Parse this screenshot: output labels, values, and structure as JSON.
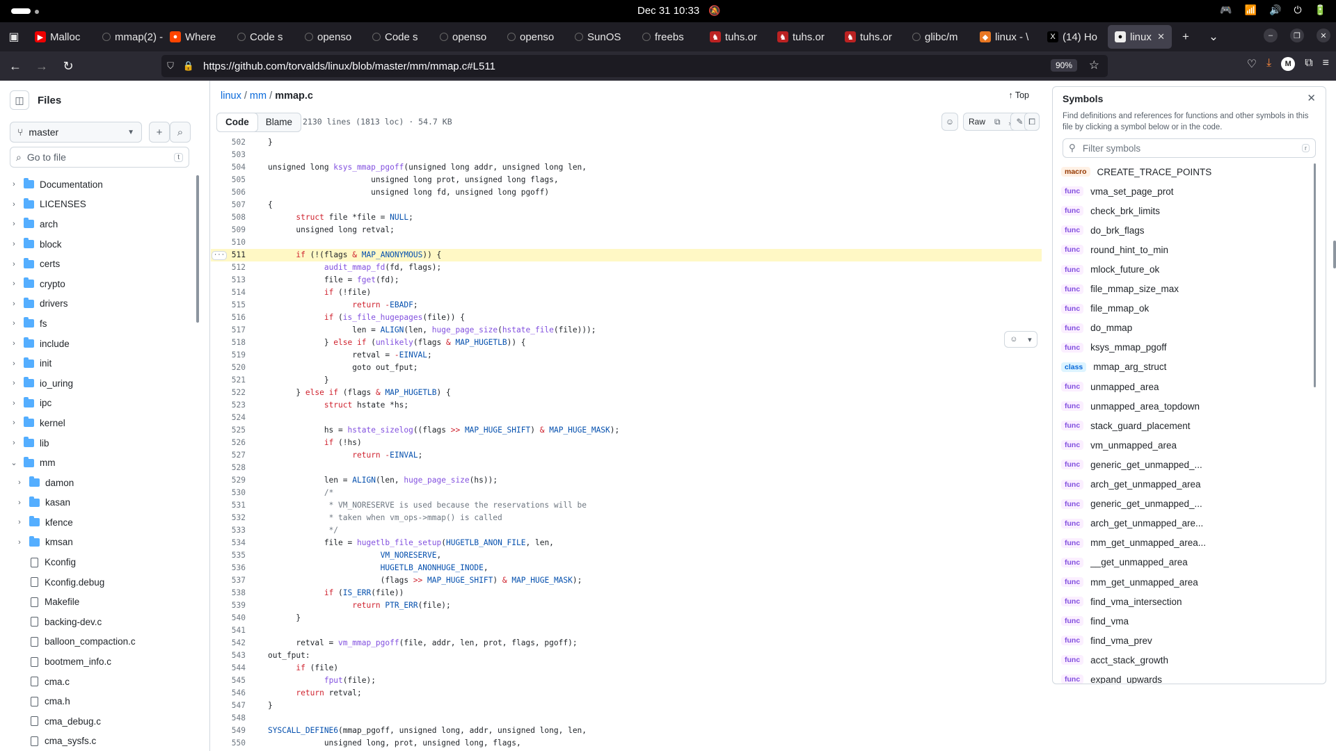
{
  "os": {
    "clock": "Dec 31  10:33"
  },
  "browser": {
    "tabs": [
      {
        "label": "Malloc",
        "fav": "#e00",
        "glyph": "▶"
      },
      {
        "label": "mmap(2) -",
        "fav": "",
        "glyph": ""
      },
      {
        "label": "Where",
        "fav": "#ff4500",
        "glyph": "●"
      },
      {
        "label": "Code s",
        "fav": "",
        "glyph": ""
      },
      {
        "label": "openso",
        "fav": "",
        "glyph": ""
      },
      {
        "label": "Code s",
        "fav": "",
        "glyph": ""
      },
      {
        "label": "openso",
        "fav": "",
        "glyph": ""
      },
      {
        "label": "openso",
        "fav": "",
        "glyph": ""
      },
      {
        "label": "SunOS",
        "fav": "",
        "glyph": ""
      },
      {
        "label": "freebs",
        "fav": "",
        "glyph": ""
      },
      {
        "label": "tuhs.or",
        "fav": "#b22",
        "glyph": "♞"
      },
      {
        "label": "tuhs.or",
        "fav": "#b22",
        "glyph": "♞"
      },
      {
        "label": "tuhs.or",
        "fav": "#b22",
        "glyph": "♞"
      },
      {
        "label": "glibc/m",
        "fav": "",
        "glyph": ""
      },
      {
        "label": "linux - \\",
        "fav": "#e87722",
        "glyph": "◆"
      },
      {
        "label": "(14) Ho",
        "fav": "#000",
        "glyph": "X"
      }
    ],
    "active_tab": "linux",
    "url": "https://github.com/torvalds/linux/blob/master/mm/mmap.c#L511",
    "zoom": "90%"
  },
  "sidebar": {
    "title": "Files",
    "branch": "master",
    "goto_placeholder": "Go to file",
    "goto_key": "t",
    "items": [
      {
        "name": "Documentation",
        "type": "folder",
        "depth": 0,
        "open": false
      },
      {
        "name": "LICENSES",
        "type": "folder",
        "depth": 0,
        "open": false
      },
      {
        "name": "arch",
        "type": "folder",
        "depth": 0,
        "open": false
      },
      {
        "name": "block",
        "type": "folder",
        "depth": 0,
        "open": false
      },
      {
        "name": "certs",
        "type": "folder",
        "depth": 0,
        "open": false
      },
      {
        "name": "crypto",
        "type": "folder",
        "depth": 0,
        "open": false
      },
      {
        "name": "drivers",
        "type": "folder",
        "depth": 0,
        "open": false
      },
      {
        "name": "fs",
        "type": "folder",
        "depth": 0,
        "open": false
      },
      {
        "name": "include",
        "type": "folder",
        "depth": 0,
        "open": false
      },
      {
        "name": "init",
        "type": "folder",
        "depth": 0,
        "open": false
      },
      {
        "name": "io_uring",
        "type": "folder",
        "depth": 0,
        "open": false
      },
      {
        "name": "ipc",
        "type": "folder",
        "depth": 0,
        "open": false
      },
      {
        "name": "kernel",
        "type": "folder",
        "depth": 0,
        "open": false
      },
      {
        "name": "lib",
        "type": "folder",
        "depth": 0,
        "open": false
      },
      {
        "name": "mm",
        "type": "folder",
        "depth": 0,
        "open": true
      },
      {
        "name": "damon",
        "type": "folder",
        "depth": 1,
        "open": false
      },
      {
        "name": "kasan",
        "type": "folder",
        "depth": 1,
        "open": false
      },
      {
        "name": "kfence",
        "type": "folder",
        "depth": 1,
        "open": false
      },
      {
        "name": "kmsan",
        "type": "folder",
        "depth": 1,
        "open": false
      },
      {
        "name": "Kconfig",
        "type": "file",
        "depth": 1
      },
      {
        "name": "Kconfig.debug",
        "type": "file",
        "depth": 1
      },
      {
        "name": "Makefile",
        "type": "file",
        "depth": 1
      },
      {
        "name": "backing-dev.c",
        "type": "file",
        "depth": 1
      },
      {
        "name": "balloon_compaction.c",
        "type": "file",
        "depth": 1
      },
      {
        "name": "bootmem_info.c",
        "type": "file",
        "depth": 1
      },
      {
        "name": "cma.c",
        "type": "file",
        "depth": 1
      },
      {
        "name": "cma.h",
        "type": "file",
        "depth": 1
      },
      {
        "name": "cma_debug.c",
        "type": "file",
        "depth": 1
      },
      {
        "name": "cma_sysfs.c",
        "type": "file",
        "depth": 1
      }
    ]
  },
  "main": {
    "crumbs": {
      "repo": "linux",
      "dir": "mm",
      "file": "mmap.c",
      "sep": "/"
    },
    "top_label": "Top",
    "tab_code": "Code",
    "tab_blame": "Blame",
    "file_info": "2130 lines (1813 loc) · 54.7 KB",
    "raw_label": "Raw",
    "highlight_line": 511,
    "code_lines": [
      {
        "n": 502,
        "t": "}"
      },
      {
        "n": 503,
        "t": ""
      },
      {
        "n": 504,
        "t": "unsigned long <f>ksys_mmap_pgoff</f>(unsigned long addr, unsigned long len,"
      },
      {
        "n": 505,
        "t": "                      unsigned long prot, unsigned long flags,"
      },
      {
        "n": 506,
        "t": "                      unsigned long fd, unsigned long pgoff)"
      },
      {
        "n": 507,
        "t": "{"
      },
      {
        "n": 508,
        "t": "      <k>struct</k> file *file = <m>NULL</m>;"
      },
      {
        "n": 509,
        "t": "      unsigned long retval;"
      },
      {
        "n": 510,
        "t": ""
      },
      {
        "n": 511,
        "t": "      <k>if</k> (!(flags <k>&amp;</k> <m>MAP_ANONYMOUS</m>)) {"
      },
      {
        "n": 512,
        "t": "            <f>audit_mmap_fd</f>(fd, flags);"
      },
      {
        "n": 513,
        "t": "            file = <f>fget</f>(fd);"
      },
      {
        "n": 514,
        "t": "            <k>if</k> (!file)"
      },
      {
        "n": 515,
        "t": "                  <k>return</k> <k>-</k><m>EBADF</m>;"
      },
      {
        "n": 516,
        "t": "            <k>if</k> (<f>is_file_hugepages</f>(file)) {"
      },
      {
        "n": 517,
        "t": "                  len = <m>ALIGN</m>(len, <f>huge_page_size</f>(<f>hstate_file</f>(file)));"
      },
      {
        "n": 518,
        "t": "            } <k>else if</k> (<f>unlikely</f>(flags <k>&amp;</k> <m>MAP_HUGETLB</m>)) {"
      },
      {
        "n": 519,
        "t": "                  retval = <k>-</k><m>EINVAL</m>;"
      },
      {
        "n": 520,
        "t": "                  goto out_fput;"
      },
      {
        "n": 521,
        "t": "            }"
      },
      {
        "n": 522,
        "t": "      } <k>else if</k> (flags <k>&amp;</k> <m>MAP_HUGETLB</m>) {"
      },
      {
        "n": 523,
        "t": "            <k>struct</k> hstate *hs;"
      },
      {
        "n": 524,
        "t": ""
      },
      {
        "n": 525,
        "t": "            hs = <f>hstate_sizelog</f>((flags <k>&gt;&gt;</k> <m>MAP_HUGE_SHIFT</m>) <k>&amp;</k> <m>MAP_HUGE_MASK</m>);"
      },
      {
        "n": 526,
        "t": "            <k>if</k> (!hs)"
      },
      {
        "n": 527,
        "t": "                  <k>return</k> <k>-</k><m>EINVAL</m>;"
      },
      {
        "n": 528,
        "t": ""
      },
      {
        "n": 529,
        "t": "            len = <m>ALIGN</m>(len, <f>huge_page_size</f>(hs));"
      },
      {
        "n": 530,
        "t": "            <c>/*</c>"
      },
      {
        "n": 531,
        "t": "            <c> * VM_NORESERVE is used because the reservations will be</c>"
      },
      {
        "n": 532,
        "t": "            <c> * taken when vm_ops-&gt;mmap() is called</c>"
      },
      {
        "n": 533,
        "t": "            <c> */</c>"
      },
      {
        "n": 534,
        "t": "            file = <f>hugetlb_file_setup</f>(<m>HUGETLB_ANON_FILE</m>, len,"
      },
      {
        "n": 535,
        "t": "                        <m>VM_NORESERVE</m>,"
      },
      {
        "n": 536,
        "t": "                        <m>HUGETLB_ANONHUGE_INODE</m>,"
      },
      {
        "n": 537,
        "t": "                        (flags <k>&gt;&gt;</k> <m>MAP_HUGE_SHIFT</m>) <k>&amp;</k> <m>MAP_HUGE_MASK</m>);"
      },
      {
        "n": 538,
        "t": "            <k>if</k> (<m>IS_ERR</m>(file))"
      },
      {
        "n": 539,
        "t": "                  <k>return</k> <m>PTR_ERR</m>(file);"
      },
      {
        "n": 540,
        "t": "      }"
      },
      {
        "n": 541,
        "t": ""
      },
      {
        "n": 542,
        "t": "      retval = <f>vm_mmap_pgoff</f>(file, addr, len, prot, flags, pgoff);"
      },
      {
        "n": 543,
        "t": "out_fput:"
      },
      {
        "n": 544,
        "t": "      <k>if</k> (file)"
      },
      {
        "n": 545,
        "t": "            <f>fput</f>(file);"
      },
      {
        "n": 546,
        "t": "      <k>return</k> retval;"
      },
      {
        "n": 547,
        "t": "}"
      },
      {
        "n": 548,
        "t": ""
      },
      {
        "n": 549,
        "t": "<m>SYSCALL_DEFINE6</m>(mmap_pgoff, unsigned long, addr, unsigned long, len,"
      },
      {
        "n": 550,
        "t": "            unsigned long, prot, unsigned long, flags,"
      }
    ]
  },
  "symbols": {
    "title": "Symbols",
    "description": "Find definitions and references for functions and other symbols in this file by clicking a symbol below or in the code.",
    "filter_placeholder": "Filter symbols",
    "filter_key": "r",
    "items": [
      {
        "kind": "macro",
        "name": "CREATE_TRACE_POINTS"
      },
      {
        "kind": "func",
        "name": "vma_set_page_prot"
      },
      {
        "kind": "func",
        "name": "check_brk_limits"
      },
      {
        "kind": "func",
        "name": "do_brk_flags"
      },
      {
        "kind": "func",
        "name": "round_hint_to_min"
      },
      {
        "kind": "func",
        "name": "mlock_future_ok"
      },
      {
        "kind": "func",
        "name": "file_mmap_size_max"
      },
      {
        "kind": "func",
        "name": "file_mmap_ok"
      },
      {
        "kind": "func",
        "name": "do_mmap"
      },
      {
        "kind": "func",
        "name": "ksys_mmap_pgoff"
      },
      {
        "kind": "class",
        "name": "mmap_arg_struct"
      },
      {
        "kind": "func",
        "name": "unmapped_area"
      },
      {
        "kind": "func",
        "name": "unmapped_area_topdown"
      },
      {
        "kind": "func",
        "name": "stack_guard_placement"
      },
      {
        "kind": "func",
        "name": "vm_unmapped_area"
      },
      {
        "kind": "func",
        "name": "generic_get_unmapped_..."
      },
      {
        "kind": "func",
        "name": "arch_get_unmapped_area"
      },
      {
        "kind": "func",
        "name": "generic_get_unmapped_..."
      },
      {
        "kind": "func",
        "name": "arch_get_unmapped_are..."
      },
      {
        "kind": "func",
        "name": "mm_get_unmapped_area..."
      },
      {
        "kind": "func",
        "name": "__get_unmapped_area"
      },
      {
        "kind": "func",
        "name": "mm_get_unmapped_area"
      },
      {
        "kind": "func",
        "name": "find_vma_intersection"
      },
      {
        "kind": "func",
        "name": "find_vma"
      },
      {
        "kind": "func",
        "name": "find_vma_prev"
      },
      {
        "kind": "func",
        "name": "acct_stack_growth"
      },
      {
        "kind": "func",
        "name": "expand_upwards"
      }
    ]
  }
}
